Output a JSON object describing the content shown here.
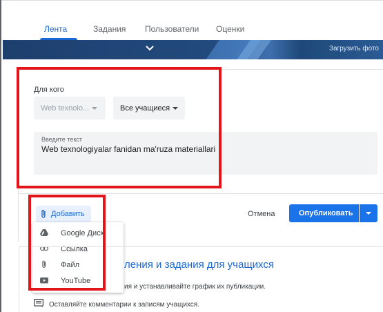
{
  "nav": {
    "tabs": [
      {
        "label": "Лента",
        "active": true
      },
      {
        "label": "Задания",
        "active": false
      },
      {
        "label": "Пользователи",
        "active": false
      },
      {
        "label": "Оценки",
        "active": false
      }
    ]
  },
  "banner": {
    "upload_label": "Загрузить фото",
    "icon": "chevron-down-icon"
  },
  "post_form": {
    "for_label": "Для кого",
    "course_select": "Web texnolo...",
    "audience_select": "Все учащиеся",
    "text_placeholder": "Введите текст",
    "text_value": "Web texnologiyalar fanidan ma'ruza materiallari"
  },
  "attach": {
    "add_label": "Добавить",
    "menu": [
      {
        "label": "Google Диск",
        "icon": "google-drive-icon"
      },
      {
        "label": "Ссылка",
        "icon": "link-icon"
      },
      {
        "label": "Файл",
        "icon": "paperclip-icon"
      },
      {
        "label": "YouTube",
        "icon": "youtube-icon"
      }
    ]
  },
  "actions": {
    "cancel_label": "Отмена",
    "publish_label": "Опубликовать"
  },
  "lower": {
    "heading": "ления и задания для учащихся",
    "line1": "ия и устанавливайте график их публикации.",
    "line2": "Оставляйте комментарии к записям учащихся."
  },
  "colors": {
    "accent": "#1a73e8",
    "highlight": "#e4141b",
    "tab_active": "#1967d2"
  }
}
